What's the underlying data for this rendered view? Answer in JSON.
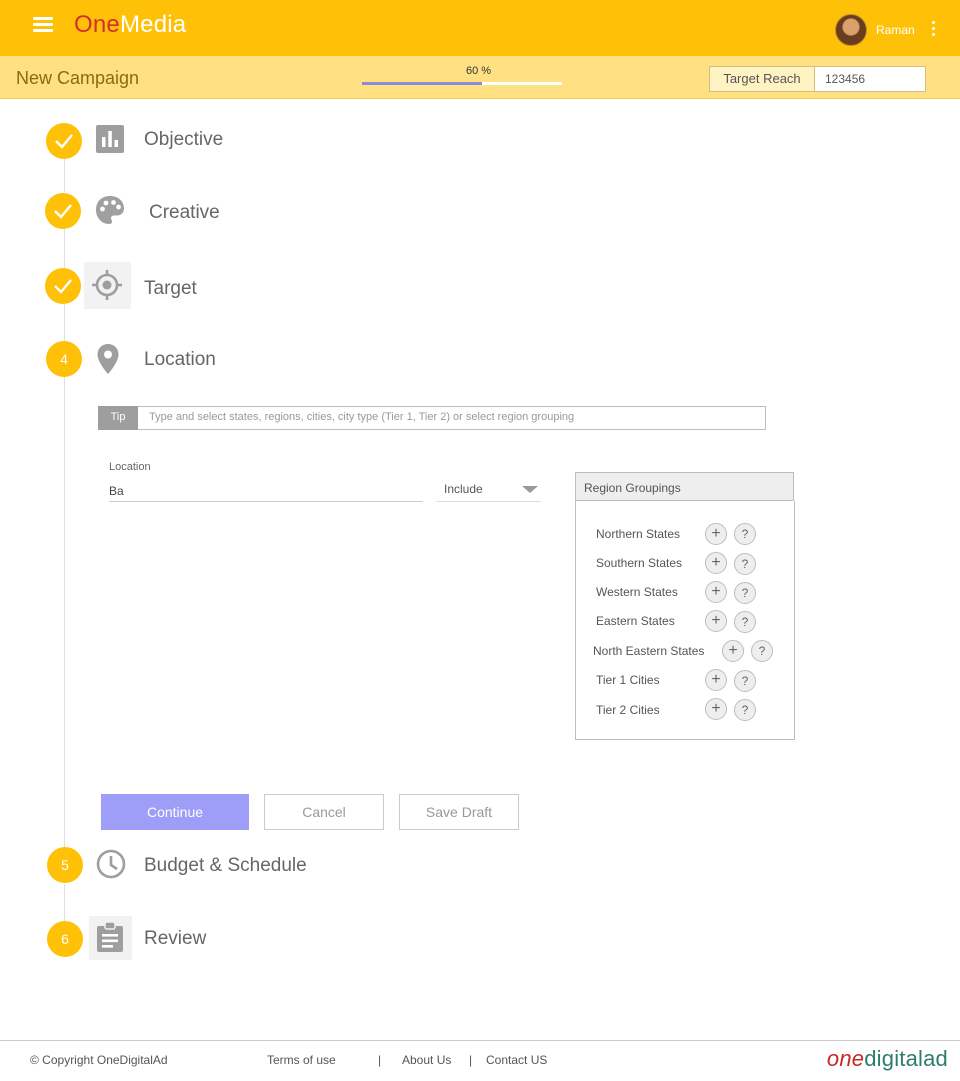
{
  "app": {
    "brand_one": "One",
    "brand_media": "Media",
    "user_name": "Raman"
  },
  "campaign": {
    "title": "New Campaign",
    "progress_label": "60 %",
    "progress_fraction": 0.6,
    "target_reach_label": "Target Reach",
    "target_reach_value": "123456"
  },
  "steps": [
    {
      "title": "Objective",
      "state": "done",
      "icon": "bar-chart-icon"
    },
    {
      "title": "Creative",
      "state": "done",
      "icon": "palette-icon"
    },
    {
      "title": "Target",
      "state": "done",
      "icon": "crosshair-icon"
    },
    {
      "number": "4",
      "title": "Location",
      "state": "active",
      "icon": "map-pin-icon"
    },
    {
      "number": "5",
      "title": "Budget & Schedule",
      "state": "pending",
      "icon": "clock-icon"
    },
    {
      "number": "6",
      "title": "Review",
      "state": "pending",
      "icon": "clipboard-icon"
    }
  ],
  "location": {
    "tip_label": "Tip",
    "tip_text": "Type and select states, regions, cities, city type (Tier 1, Tier 2) or select region grouping",
    "field_label": "Location",
    "field_value": "Ba",
    "mode": "Include",
    "groupings_title": "Region Groupings",
    "groupings": [
      {
        "name": "Northern States"
      },
      {
        "name": "Southern States"
      },
      {
        "name": "Western States"
      },
      {
        "name": "Eastern States"
      },
      {
        "name": "North Eastern States"
      },
      {
        "name": "Tier 1 Cities"
      },
      {
        "name": "Tier 2 Cities"
      }
    ],
    "add_symbol": "+",
    "help_symbol": "?"
  },
  "actions": {
    "continue": "Continue",
    "cancel": "Cancel",
    "save_draft": "Save Draft"
  },
  "footer": {
    "copyright": "© Copyright OneDigitalAd",
    "terms": "Terms of use",
    "about": "About Us",
    "contact": "Contact US",
    "separator": "|",
    "logo_one": "one",
    "logo_digitalad": "digitalad"
  },
  "colors": {
    "accent": "#ffc107",
    "subbar": "#ffe082",
    "primary_button": "#9e9ef8",
    "brand_red": "#d32f2f",
    "logo_green": "#2e7d6a"
  }
}
